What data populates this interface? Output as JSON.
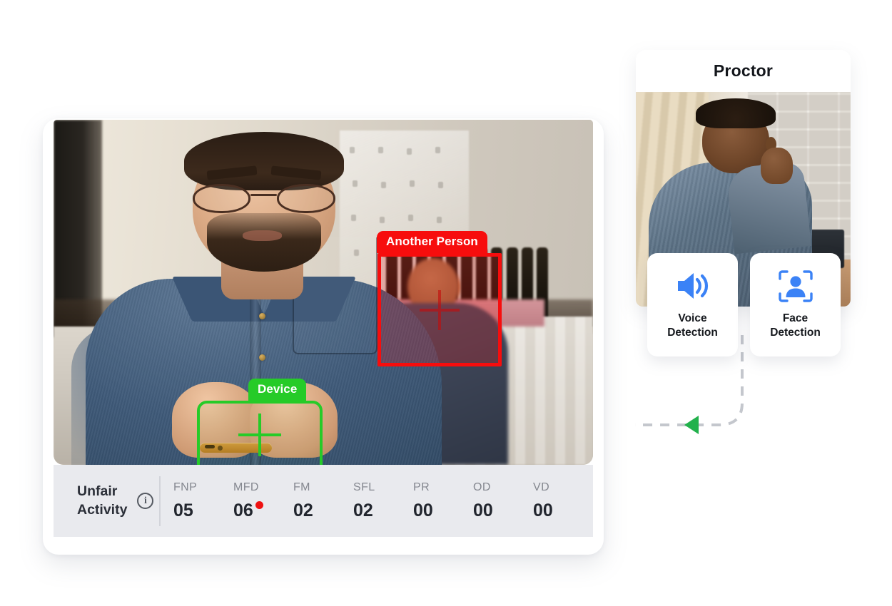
{
  "candidate_panel": {
    "detections": [
      {
        "id": "another-person",
        "label": "Another Person",
        "color": "#f70d0d",
        "type": "violation"
      },
      {
        "id": "device",
        "label": "Device",
        "color": "#26cb28",
        "type": "object"
      }
    ],
    "stats_bar": {
      "title": "Unfair\nActivity",
      "info_icon": "info-circle-icon",
      "alert_color": "#ee1111",
      "metrics": [
        {
          "key": "FNP",
          "value": "05",
          "alert": false
        },
        {
          "key": "MFD",
          "value": "06",
          "alert": true
        },
        {
          "key": "FM",
          "value": "02",
          "alert": false
        },
        {
          "key": "SFL",
          "value": "02",
          "alert": false
        },
        {
          "key": "PR",
          "value": "00",
          "alert": false
        },
        {
          "key": "OD",
          "value": "00",
          "alert": false
        },
        {
          "key": "VD",
          "value": "00",
          "alert": false
        }
      ]
    }
  },
  "proctor_panel": {
    "title": "Proctor",
    "detection_cards": [
      {
        "id": "voice-detection",
        "label": "Voice\nDetection",
        "icon": "speaker-volume-icon",
        "color": "#3b82f6"
      },
      {
        "id": "face-detection",
        "label": "Face\nDetection",
        "icon": "face-scan-icon",
        "color": "#3b82f6"
      }
    ],
    "connector": {
      "arrow_color": "#22b14c",
      "line_color": "#c4c7cd",
      "style": "dashed"
    }
  }
}
